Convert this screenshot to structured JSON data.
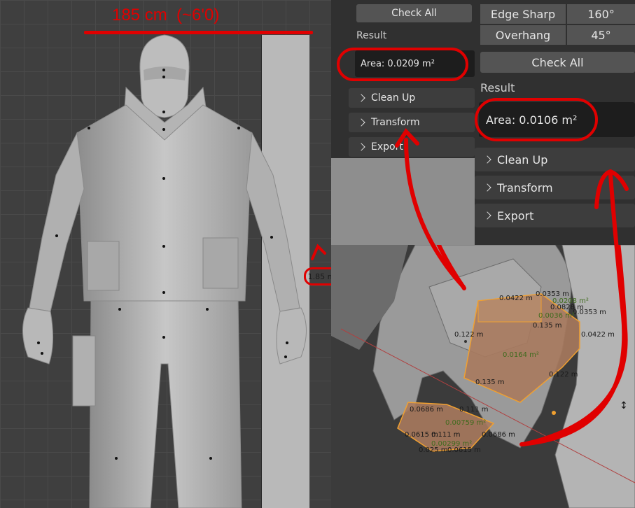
{
  "annotations": {
    "height_label": "185 cm  (~6'0)",
    "small_label": "1.85 m"
  },
  "panel_a": {
    "check_all": "Check All",
    "result_label": "Result",
    "area": "Area: 0.0209 m²",
    "sections": [
      "Clean Up",
      "Transform",
      "Export"
    ]
  },
  "panel_b": {
    "properties": [
      {
        "name": "Edge Sharp",
        "value": "160°"
      },
      {
        "name": "Overhang",
        "value": "45°"
      }
    ],
    "check_all": "Check All",
    "result_label": "Result",
    "area": "Area: 0.0106 m²",
    "sections": [
      "Clean Up",
      "Transform",
      "Export"
    ]
  },
  "measurements": {
    "large_face": [
      "0.0422 m",
      "0.0353 m",
      "0.0208 m²",
      "0.0828 m",
      "0.0353 m",
      "0.0036 m²",
      "0.135 m",
      "0.0422 m",
      "0.122 m",
      "0.0164 m²",
      "0.122 m",
      "0.135 m"
    ],
    "small_face": [
      "0.0686 m",
      "0.111 m",
      "0.00759 m²",
      "0.0615 m",
      "0.111 m",
      "0.0686 m",
      "0.00299 m²",
      "0.025 m",
      "0.0615 m"
    ]
  },
  "colors": {
    "annotation_red": "#e00000",
    "face_fill": "#a87a5e",
    "face_edge": "#f0a030"
  }
}
